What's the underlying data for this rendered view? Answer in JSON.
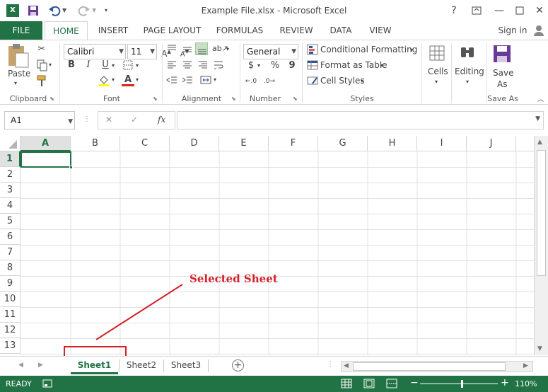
{
  "window": {
    "title": "Example File.xlsx - Microsoft Excel"
  },
  "ribbon_tabs": [
    "FILE",
    "HOME",
    "INSERT",
    "PAGE LAYOUT",
    "FORMULAS",
    "REVIEW",
    "DATA",
    "VIEW"
  ],
  "sign_in": "Sign in",
  "clipboard": {
    "paste": "Paste",
    "label": "Clipboard"
  },
  "font": {
    "name": "Calibri",
    "size": "11",
    "label": "Font",
    "bold": "B",
    "italic": "I",
    "underline": "U"
  },
  "alignment": {
    "label": "Alignment"
  },
  "number": {
    "format": "General",
    "label": "Number",
    "currency": "$",
    "percent": "%",
    "comma": "9"
  },
  "styles": {
    "conditional": "Conditional Formatting",
    "format_table": "Format as Table",
    "cell_styles": "Cell Styles",
    "label": "Styles"
  },
  "cells": {
    "label": "Cells"
  },
  "editing": {
    "label": "Editing"
  },
  "save_as": {
    "line1": "Save",
    "line2": "As",
    "label": "Save As"
  },
  "formula_bar": {
    "name_box": "A1",
    "fx": "fx",
    "cancel": "✕",
    "enter": "✓"
  },
  "columns": [
    "A",
    "B",
    "C",
    "D",
    "E",
    "F",
    "G",
    "H",
    "I",
    "J"
  ],
  "rows": [
    "1",
    "2",
    "3",
    "4",
    "5",
    "6",
    "7",
    "8",
    "9",
    "10",
    "11",
    "12",
    "13"
  ],
  "sheets": [
    "Sheet1",
    "Sheet2",
    "Sheet3"
  ],
  "annotation": {
    "text": "Selected Sheet",
    "color": "#d32027"
  },
  "status": {
    "ready": "READY",
    "zoom": "110%"
  },
  "colors": {
    "accent": "#217346"
  }
}
